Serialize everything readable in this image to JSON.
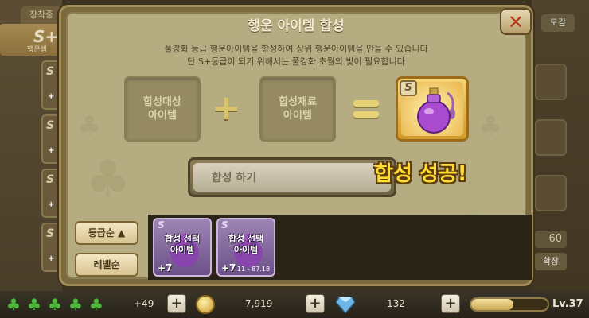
{
  "background": {
    "left_tab": "장착중",
    "equipped_badge": "S+",
    "equipped_sub": "행운템",
    "left_slots": [
      {
        "grade": "S",
        "plus": "+"
      },
      {
        "grade": "S",
        "plus": "+"
      },
      {
        "grade": "S",
        "plus": "+"
      },
      {
        "grade": "S",
        "plus": "+"
      }
    ],
    "right_button": "도감",
    "right_count": "60",
    "right_expand": "확장"
  },
  "dialog": {
    "title": "행운 아이템 합성",
    "description_line1": "풀강화  등급 행운아이템을 합성하여 상위 행운아이템을 만들 수 있습니다",
    "description_line2": "단 S+등급이 되기 위해서는 풀강화 초월의 빛이 필요합니다",
    "target_slot": {
      "line1": "합성대상",
      "line2": "아이템"
    },
    "material_slot": {
      "line1": "합성재료",
      "line2": "아이템"
    },
    "result_grade": "S",
    "synth_button": "합성 하기",
    "success_text": "합성 성공!",
    "close_icon": "close-icon"
  },
  "sort": {
    "grade_sort": "등급순 ▲",
    "level_sort": "레벨순"
  },
  "inventory": [
    {
      "grade": "S",
      "label_line1": "합성 선택",
      "label_line2": "아이템",
      "plus": "+7",
      "progress": ""
    },
    {
      "grade": "S",
      "label_line1": "합성 선택",
      "label_line2": "아이템",
      "plus": "+7",
      "progress": "11 - 87.18"
    }
  ],
  "bottombar": {
    "clover_count": 5,
    "clover_extra": "+49",
    "gold": "7,919",
    "gems": "132",
    "level": "Lv.37",
    "xp_fraction": 0.55
  },
  "colors": {
    "success": "#ffdc34",
    "close": "#b83a1f",
    "clover": "#4fb63e"
  }
}
